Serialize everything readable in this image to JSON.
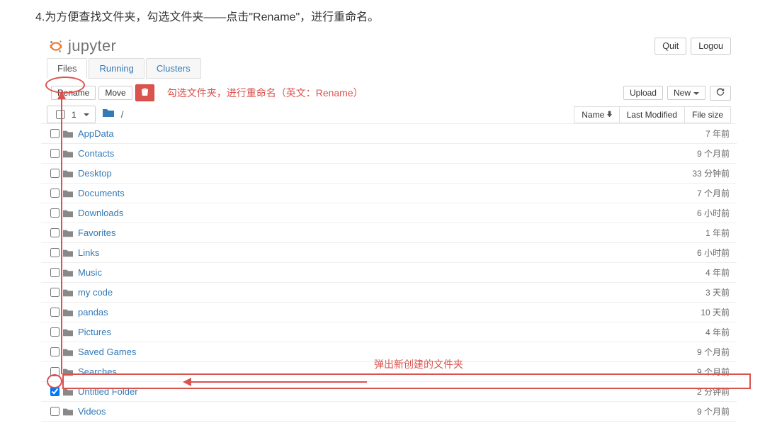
{
  "instruction": "4.为方便查找文件夹，勾选文件夹——点击\"Rename\"，进行重命名。",
  "header": {
    "logo_text": "jupyter",
    "quit": "Quit",
    "logout": "Logou"
  },
  "tabs": {
    "files": "Files",
    "running": "Running",
    "clusters": "Clusters"
  },
  "actions": {
    "rename": "Rename",
    "move": "Move",
    "upload": "Upload",
    "new": "New"
  },
  "annot_action": "勾选文件夹，进行重命名（英文：Rename）",
  "annot_arrow": "弹出新创建的文件夹",
  "breadcrumb": {
    "count_label": "1",
    "root_slash": "/"
  },
  "sort": {
    "name": "Name",
    "last_modified": "Last Modified",
    "file_size": "File size"
  },
  "files": [
    {
      "name": "AppData",
      "time": "7 年前",
      "checked": false
    },
    {
      "name": "Contacts",
      "time": "9 个月前",
      "checked": false
    },
    {
      "name": "Desktop",
      "time": "33 分钟前",
      "checked": false
    },
    {
      "name": "Documents",
      "time": "7 个月前",
      "checked": false
    },
    {
      "name": "Downloads",
      "time": "6 小时前",
      "checked": false
    },
    {
      "name": "Favorites",
      "time": "1 年前",
      "checked": false
    },
    {
      "name": "Links",
      "time": "6 小时前",
      "checked": false
    },
    {
      "name": "Music",
      "time": "4 年前",
      "checked": false
    },
    {
      "name": "my code",
      "time": "3 天前",
      "checked": false
    },
    {
      "name": "pandas",
      "time": "10 天前",
      "checked": false
    },
    {
      "name": "Pictures",
      "time": "4 年前",
      "checked": false
    },
    {
      "name": "Saved Games",
      "time": "9 个月前",
      "checked": false
    },
    {
      "name": "Searches",
      "time": "9 个月前",
      "checked": false
    },
    {
      "name": "Untitled Folder",
      "time": "2 分钟前",
      "checked": true
    },
    {
      "name": "Videos",
      "time": "9 个月前",
      "checked": false
    }
  ]
}
